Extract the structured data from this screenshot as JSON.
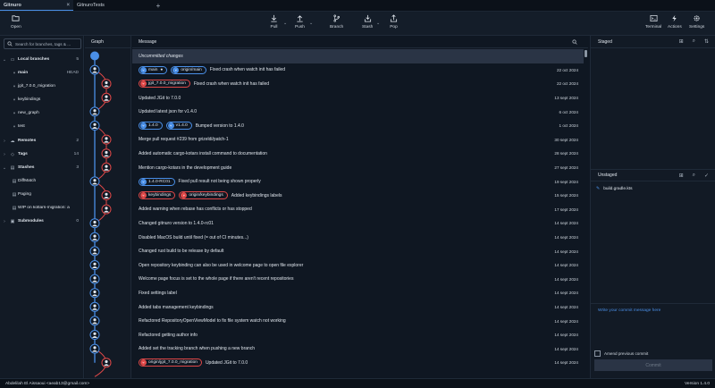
{
  "tabs": [
    {
      "label": "Gitnuro",
      "active": true
    },
    {
      "label": "GitnuroTests",
      "active": false
    }
  ],
  "toolbar": {
    "open": "Open",
    "pull": "Pull",
    "push": "Push",
    "branch": "Branch",
    "stash": "Stash",
    "pop": "Pop",
    "terminal": "Terminal",
    "actions": "Actions",
    "settings": "Settings"
  },
  "sidebar": {
    "search_placeholder": "Search for branches, tags & ...",
    "local_branches": {
      "label": "Local branches",
      "count": "5"
    },
    "branches": [
      {
        "name": "main",
        "badge": "HEAD"
      },
      {
        "name": "jgit_7.0.0_migration",
        "badge": ""
      },
      {
        "name": "keybindings",
        "badge": ""
      },
      {
        "name": "new_graph",
        "badge": ""
      },
      {
        "name": "test",
        "badge": ""
      }
    ],
    "remotes": {
      "label": "Remotes",
      "count": "2"
    },
    "tags": {
      "label": "Tags",
      "count": "14"
    },
    "stashes": {
      "label": "Stashes",
      "count": "3"
    },
    "stash_items": [
      "DiffMatch",
      "Paging",
      "WIP on kotlars-migration: a"
    ],
    "submodules": {
      "label": "Submodules",
      "count": "0"
    }
  },
  "graph": {
    "header": "Graph"
  },
  "log": {
    "header": "Message",
    "rows": [
      {
        "message": "Uncommitted changes",
        "date": "",
        "refs": [],
        "uncommitted": true
      },
      {
        "message": "Fixed crash when watch init has failed",
        "date": "22 oct 2024",
        "refs": [
          {
            "label": "main",
            "color": "blue",
            "head": true
          },
          {
            "label": "origin/main",
            "color": "blue"
          }
        ]
      },
      {
        "message": "Fixed crash when watch init has failed",
        "date": "22 oct 2024",
        "refs": [
          {
            "label": "jgit_7.0.0_migration",
            "color": "red"
          }
        ]
      },
      {
        "message": "Updated JGit to 7.0.0",
        "date": "13 sept 2024",
        "refs": []
      },
      {
        "message": "Updated latest json for v1.4.0",
        "date": "6 oct 2024",
        "refs": []
      },
      {
        "message": "Bumped version to 1.4.0",
        "date": "1 oct 2024",
        "refs": [
          {
            "label": "1.4.0",
            "color": "blue"
          },
          {
            "label": "v1.4.0",
            "color": "blue"
          }
        ]
      },
      {
        "message": "Merge pull request #239 from grizeldi/patch-1",
        "date": "30 sept 2024",
        "refs": []
      },
      {
        "message": "Added automatic cargo-kotars install command to documentation",
        "date": "28 sept 2024",
        "refs": []
      },
      {
        "message": "Mention cargo-kotars in the development guide",
        "date": "27 sept 2024",
        "refs": []
      },
      {
        "message": "Fixed pull result not being shown properly",
        "date": "19 sept 2024",
        "refs": [
          {
            "label": "1.4.0-RC01",
            "color": "blue"
          }
        ]
      },
      {
        "message": "Added keybindings labels",
        "date": "15 sept 2024",
        "refs": [
          {
            "label": "keybindings",
            "color": "red"
          },
          {
            "label": "origin/keybindings",
            "color": "red"
          }
        ]
      },
      {
        "message": "Added warning when rebase has conflicts or has stopped",
        "date": "17 sept 2024",
        "refs": []
      },
      {
        "message": "Changed gitnuro version to 1.4.0-rc01",
        "date": "14 sept 2024",
        "refs": []
      },
      {
        "message": "Disabled MacOS build until fixed (= out of CI minutes...)",
        "date": "14 sept 2024",
        "refs": []
      },
      {
        "message": "Changed rust build to be release by default",
        "date": "14 sept 2024",
        "refs": []
      },
      {
        "message": "Open repository keybinding can also be used in welcome page to open file explorer",
        "date": "14 sept 2024",
        "refs": []
      },
      {
        "message": "Welcome page focus is set to the whole page if there aren't recent repositories",
        "date": "14 sept 2024",
        "refs": []
      },
      {
        "message": "Fixed settings label",
        "date": "14 sept 2024",
        "refs": []
      },
      {
        "message": "Added tabs management keybindings",
        "date": "14 sept 2024",
        "refs": []
      },
      {
        "message": "Refactored RepositoryOpenViewModel to fix file system watch not working",
        "date": "14 sept 2024",
        "refs": []
      },
      {
        "message": "Refactored getting author info",
        "date": "14 sept 2024",
        "refs": []
      },
      {
        "message": "Added set the tracking branch when pushing a new branch",
        "date": "14 sept 2024",
        "refs": []
      },
      {
        "message": "Updated JGit to 7.0.0",
        "date": "14 sept 2024",
        "refs": [
          {
            "label": "origin/jgit_7.0.0_migration",
            "color": "red"
          }
        ]
      }
    ]
  },
  "staged": {
    "header": "Staged"
  },
  "unstaged": {
    "header": "Unstaged",
    "files": [
      "build.gradle.kts"
    ]
  },
  "commit": {
    "placeholder": "Write your commit message here",
    "amend_label": "Amend previous commit",
    "button": "Commit"
  },
  "status": {
    "author": "Abdelilah El Aissaoui <aeab13@gmail.com>",
    "version": "Version 1.4.0"
  },
  "colors": {
    "accent": "#4a8fe7",
    "remote": "#e04848"
  }
}
